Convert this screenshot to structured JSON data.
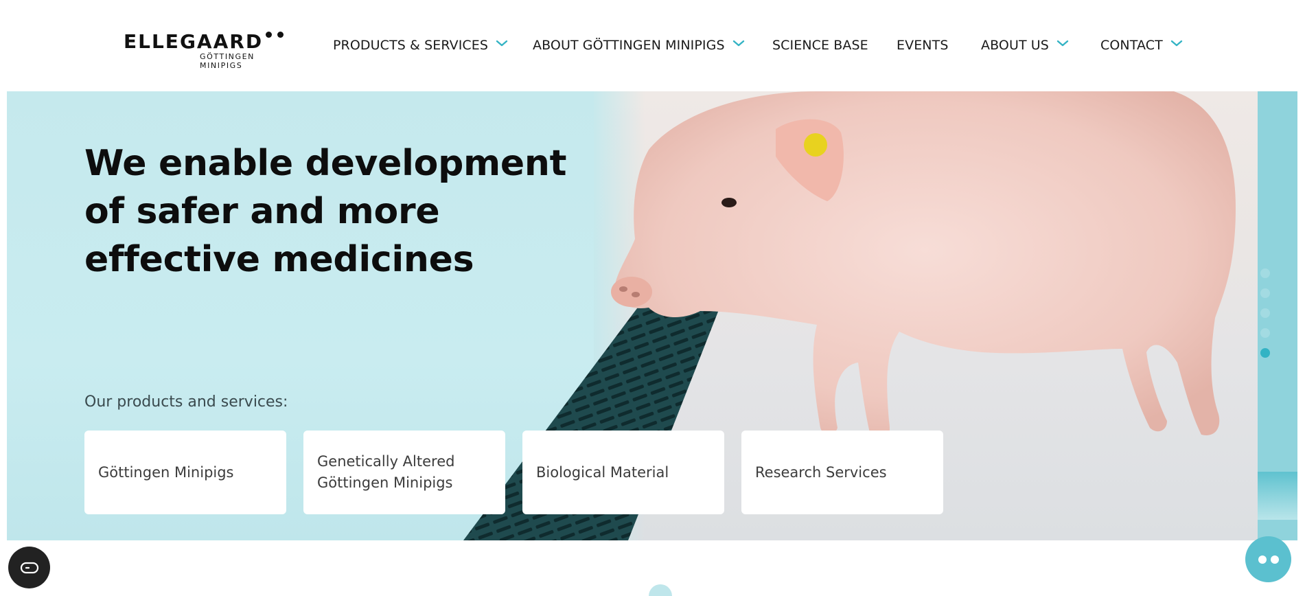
{
  "brand": {
    "name": "ELLEGAARD",
    "tagline": "GÖTTINGEN MINIPIGS"
  },
  "nav": {
    "items": [
      {
        "label": "PRODUCTS & SERVICES",
        "has_dropdown": true
      },
      {
        "label": "ABOUT GÖTTINGEN MINIPIGS",
        "has_dropdown": true
      },
      {
        "label": "SCIENCE BASE",
        "has_dropdown": false
      },
      {
        "label": "EVENTS",
        "has_dropdown": false
      },
      {
        "label": "ABOUT US",
        "has_dropdown": true
      },
      {
        "label": "CONTACT",
        "has_dropdown": true
      }
    ]
  },
  "hero": {
    "headline": "We enable development of safer and more effective medicines",
    "products_label": "Our products and services:",
    "cards": [
      {
        "label": "Göttingen Minipigs"
      },
      {
        "label": "Genetically Altered Göttingen Minipigs"
      },
      {
        "label": "Biological Material"
      },
      {
        "label": "Research Services"
      }
    ],
    "slides": {
      "count": 5,
      "active_index": 4
    }
  },
  "colors": {
    "accent": "#33b3c4",
    "hero_bg": "#c6eaee",
    "text": "#111111",
    "chat_button": "#5bc0cf",
    "accessibility_button": "#222222"
  },
  "icons": {
    "dropdown": "chevron-down-icon",
    "accessibility": "accessibility-icon",
    "chat": "chat-icon"
  }
}
